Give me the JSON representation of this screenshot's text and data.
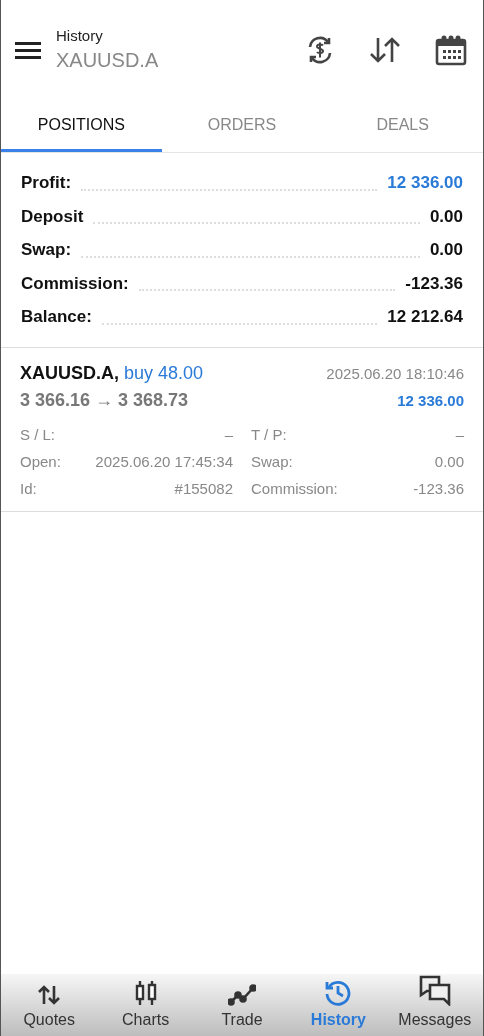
{
  "header": {
    "title": "History",
    "subtitle": "XAUUSD.A",
    "actions": [
      {
        "kind": "currency-sync"
      },
      {
        "kind": "sort"
      },
      {
        "kind": "calendar"
      }
    ]
  },
  "tabs": [
    {
      "label": "POSITIONS",
      "selected": true
    },
    {
      "label": "ORDERS",
      "selected": false
    },
    {
      "label": "DEALS",
      "selected": false
    }
  ],
  "summary": [
    {
      "label": "Profit:",
      "value": "12 336.00",
      "accent": true
    },
    {
      "label": "Deposit",
      "value": "0.00",
      "accent": false
    },
    {
      "label": "Swap:",
      "value": "0.00",
      "accent": false
    },
    {
      "label": "Commission:",
      "value": "-123.36",
      "accent": false
    },
    {
      "label": "Balance:",
      "value": "12 212.64",
      "accent": false
    }
  ],
  "positions": [
    {
      "symbol": "XAUUSD.A,",
      "type": "buy 48.00",
      "prices": "3 366.16 → 3 368.73",
      "time": "2025.06.20 18:10:46",
      "profit": "12 336.00",
      "details": [
        {
          "label": "S / L:",
          "value": "–"
        },
        {
          "label": "T / P:",
          "value": "–"
        },
        {
          "label": "Open:",
          "value": "2025.06.20 17:45:34"
        },
        {
          "label": "Swap:",
          "value": "0.00"
        },
        {
          "label": "Id:",
          "value": "#155082"
        },
        {
          "label": "Commission:",
          "value": "-123.36"
        }
      ]
    }
  ],
  "bottom_nav": [
    {
      "kind": "quotes",
      "label": "Quotes",
      "selected": false
    },
    {
      "kind": "charts",
      "label": "Charts",
      "selected": false
    },
    {
      "kind": "trade",
      "label": "Trade",
      "selected": false
    },
    {
      "kind": "history",
      "label": "History",
      "selected": true
    },
    {
      "kind": "messages",
      "label": "Messages",
      "selected": false
    }
  ]
}
